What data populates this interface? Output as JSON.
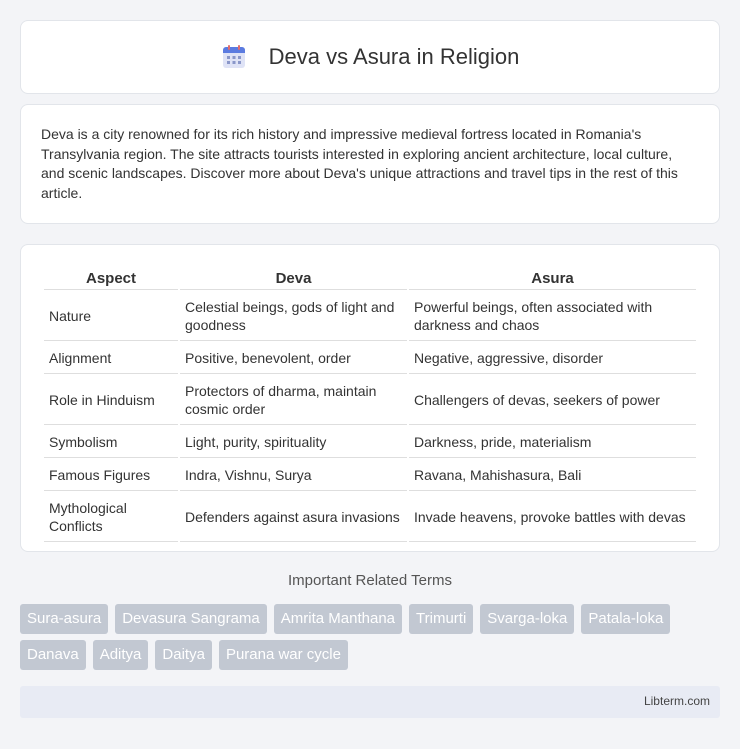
{
  "header": {
    "title": "Deva vs Asura in Religion",
    "icon": "calendar-icon"
  },
  "intro": {
    "text": "Deva is a city renowned for its rich history and impressive medieval fortress located in Romania's Transylvania region. The site attracts tourists interested in exploring ancient architecture, local culture, and scenic landscapes. Discover more about Deva's unique attractions and travel tips in the rest of this article."
  },
  "table": {
    "headers": [
      "Aspect",
      "Deva",
      "Asura"
    ],
    "rows": [
      [
        "Nature",
        "Celestial beings, gods of light and goodness",
        "Powerful beings, often associated with darkness and chaos"
      ],
      [
        "Alignment",
        "Positive, benevolent, order",
        "Negative, aggressive, disorder"
      ],
      [
        "Role in Hinduism",
        "Protectors of dharma, maintain cosmic order",
        "Challengers of devas, seekers of power"
      ],
      [
        "Symbolism",
        "Light, purity, spirituality",
        "Darkness, pride, materialism"
      ],
      [
        "Famous Figures",
        "Indra, Vishnu, Surya",
        "Ravana, Mahishasura, Bali"
      ],
      [
        "Mythological Conflicts",
        "Defenders against asura invasions",
        "Invade heavens, provoke battles with devas"
      ]
    ]
  },
  "terms": {
    "title": "Important Related Terms",
    "items": [
      "Sura-asura",
      "Devasura Sangrama",
      "Amrita Manthana",
      "Trimurti",
      "Svarga-loka",
      "Patala-loka",
      "Danava",
      "Aditya",
      "Daitya",
      "Purana war cycle"
    ]
  },
  "footer": {
    "site": "Libterm.com"
  },
  "colors": {
    "tag_bg": "#c2c8d2",
    "footer_bg": "#e8ebf4",
    "page_bg": "#f3f4f7"
  }
}
